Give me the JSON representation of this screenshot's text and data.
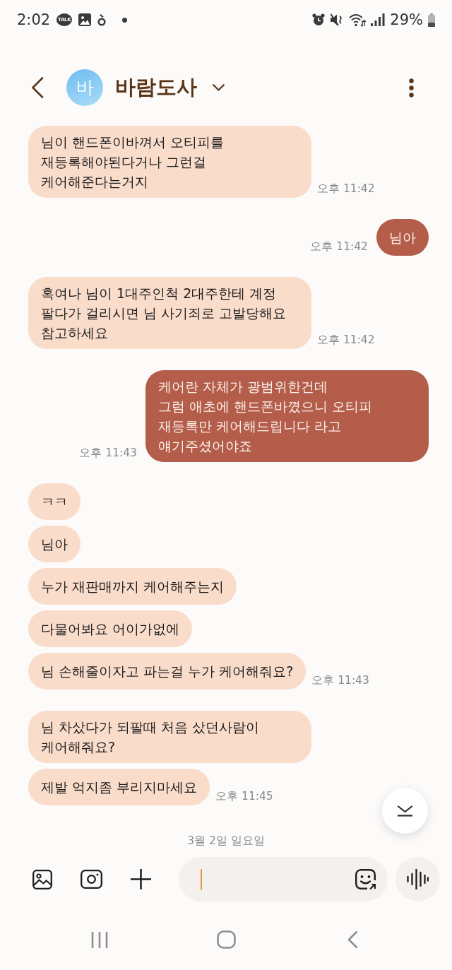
{
  "status_bar": {
    "time": "2:02",
    "chat_icon_label": "TALK",
    "battery": "29%"
  },
  "header": {
    "avatar_letter": "바",
    "contact_name": "바람도사"
  },
  "conversation": [
    {
      "kind": "received",
      "time": "오후 11:42",
      "messages": [
        {
          "lines": [
            "님이 핸드폰이바껴서 오티피를",
            "재등록해야된다거나 그런걸",
            "케어해준다는거지"
          ]
        }
      ]
    },
    {
      "kind": "sent",
      "time": "오후 11:42",
      "messages": [
        {
          "lines": [
            "님아"
          ]
        }
      ]
    },
    {
      "kind": "received",
      "time": "오후 11:42",
      "messages": [
        {
          "lines": [
            "혹여나 님이 1대주인척 2대주한테 계정",
            "팔다가 걸리시면 님 사기죄로 고발당해요",
            "참고하세요"
          ]
        }
      ]
    },
    {
      "kind": "sent",
      "time": "오후 11:43",
      "messages": [
        {
          "lines": [
            "케어란 자체가 광범위한건데",
            "그럼 애초에 핸드폰바꼈으니 오티피",
            "재등록만 케어해드립니다 라고",
            "얘기주셨어야죠"
          ]
        }
      ]
    },
    {
      "kind": "received",
      "time": "오후 11:43",
      "messages": [
        {
          "lines": [
            "ㅋㅋ"
          ]
        },
        {
          "lines": [
            "님아"
          ]
        },
        {
          "lines": [
            "누가 재판매까지 케어해주는지"
          ]
        },
        {
          "lines": [
            "다물어봐요 어이가없에"
          ]
        },
        {
          "lines": [
            "님 손해줄이자고 파는걸 누가 케어해줘요?"
          ]
        }
      ]
    },
    {
      "kind": "received",
      "time": "오후 11:45",
      "messages": [
        {
          "lines": [
            "님 차샀다가 되팔때 처음 샀던사람이",
            "케어해줘요?"
          ]
        },
        {
          "lines": [
            "제발 억지좀 부리지마세요"
          ]
        }
      ]
    }
  ],
  "date_separator": "3월 2일 일요일",
  "composer": {
    "focused": true
  }
}
